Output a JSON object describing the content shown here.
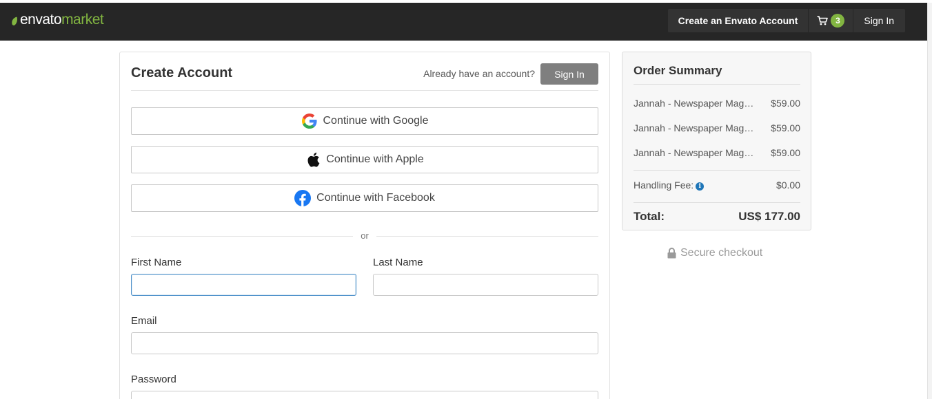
{
  "header": {
    "logo_part1": "envato",
    "logo_part2": "market",
    "create_account_label": "Create an Envato Account",
    "cart_count": "3",
    "sign_in_label": "Sign In"
  },
  "form": {
    "title": "Create Account",
    "already_text": "Already have an account?",
    "sign_in_button": "Sign In",
    "google_label": "Continue with Google",
    "apple_label": "Continue with Apple",
    "facebook_label": "Continue with Facebook",
    "or_text": "or",
    "first_name_label": "First Name",
    "first_name_value": "",
    "last_name_label": "Last Name",
    "last_name_value": "",
    "email_label": "Email",
    "email_value": "",
    "password_label": "Password",
    "password_value": ""
  },
  "summary": {
    "title": "Order Summary",
    "items": [
      {
        "name": "Jannah - Newspaper Magazine News BuddyPress AMP",
        "price": "$59.00"
      },
      {
        "name": "Jannah - Newspaper Magazine News BuddyPress AMP",
        "price": "$59.00"
      },
      {
        "name": "Jannah - Newspaper Magazine News BuddyPress AMP",
        "price": "$59.00"
      }
    ],
    "handling_label": "Handling Fee:",
    "handling_value": "$0.00",
    "total_label": "Total:",
    "total_value": "US$ 177.00"
  },
  "secure_text": "Secure checkout",
  "colors": {
    "navbar": "#262626",
    "brand_green": "#82b541",
    "signin_button": "#7f7f7f",
    "input_focus": "#4a8fc9"
  }
}
